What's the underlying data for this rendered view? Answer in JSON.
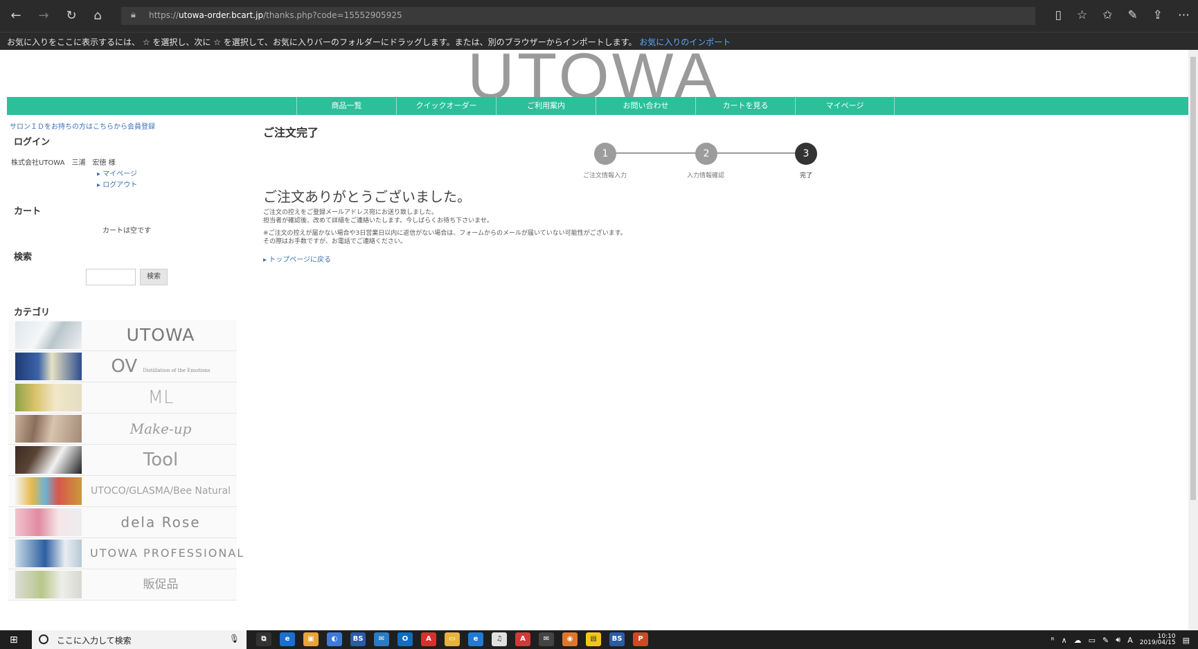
{
  "browser": {
    "url_prefix": "https://",
    "url_host": "utowa-order.bcart.jp",
    "url_path": "/thanks.php?code=15552905925",
    "favorites_message": "お気に入りをここに表示するには、 ☆ を選択し、次に ☆ を選択して、お気に入りバーのフォルダーにドラッグします。または、別のブラウザーからインポートします。",
    "favorites_import_link": "お気に入りのインポート"
  },
  "site": {
    "logo": "UTOWA",
    "menu": [
      "商品一覧",
      "クイックオーダー",
      "ご利用案内",
      "お問い合わせ",
      "カートを見る",
      "マイページ"
    ]
  },
  "sidebar": {
    "salon_link": "サロンＩＤをお持ちの方はこちらから会員登録",
    "login_heading": "ログイン",
    "user_name": "株式会社UTOWA　三浦　宏徳 様",
    "mypage_link": "▸ マイページ",
    "logout_link": "▸ ログアウト",
    "cart_heading": "カート",
    "cart_empty": "カートは空です",
    "search_heading": "検索",
    "search_button": "検索",
    "category_heading": "カテゴリ",
    "categories": [
      "UTOWA",
      "OV",
      "ML",
      "Make-up",
      "Tool",
      "UTOCO/GLASMA/Bee Natural",
      "dela Rose",
      "UTOWA PROFESSIONAL",
      "販促品"
    ],
    "category_sub_ov": "Distillation of the Emotions"
  },
  "main": {
    "title": "ご注文完了",
    "steps": [
      {
        "num": "1",
        "label": "ご注文情報入力"
      },
      {
        "num": "2",
        "label": "入力情報確認"
      },
      {
        "num": "3",
        "label": "完了"
      }
    ],
    "thanks": "ご注文ありがとうございました。",
    "message_1": "ご注文の控えをご登録メールアドレス宛にお送り致しました。",
    "message_2": "担当者が確認後、改めて詳細をご連絡いたします。今しばらくお待ち下さいませ。",
    "message_3": "※ご注文の控えが届かない場合や3日営業日以内に返信がない場合は、フォームからのメールが届いていない可能性がございます。",
    "message_4": "その際はお手数ですが、お電話でご連絡ください。",
    "top_link": "▸ トップページに戻る"
  },
  "taskbar": {
    "search_placeholder": "ここに入力して検索",
    "time": "10:10",
    "date": "2019/04/15",
    "ime": "A"
  },
  "colors": {
    "accent": "#2cbf9a",
    "browser_chrome": "#2b2b2b",
    "link": "#3b6fb6"
  }
}
